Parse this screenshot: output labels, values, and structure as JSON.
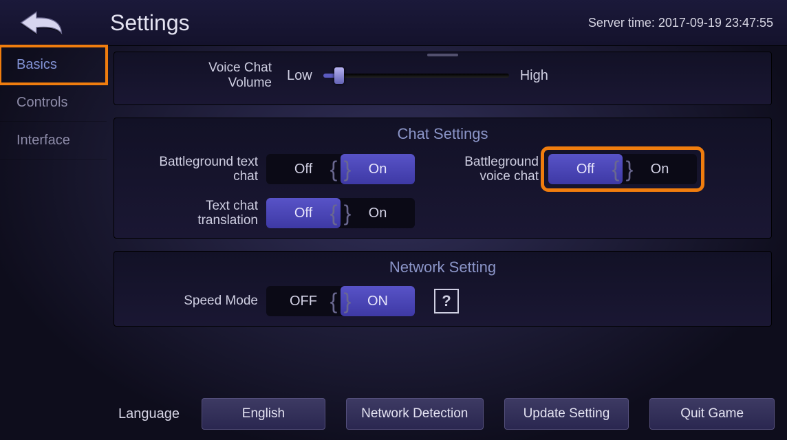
{
  "header": {
    "title": "Settings",
    "server_time_label": "Server time: 2017-09-19 23:47:55"
  },
  "sidebar": {
    "tabs": [
      {
        "label": "Basics"
      },
      {
        "label": "Controls"
      },
      {
        "label": "Interface"
      }
    ]
  },
  "voice_volume": {
    "label_line1": "Voice Chat",
    "label_line2": "Volume",
    "low": "Low",
    "high": "High",
    "value_pct": 6
  },
  "chat": {
    "section": "Chat Settings",
    "bg_text": {
      "label_l1": "Battleground text",
      "label_l2": "chat",
      "off": "Off",
      "on": "On",
      "value": "On"
    },
    "bg_voice": {
      "label_l1": "Battleground",
      "label_l2": "voice chat",
      "off": "Off",
      "on": "On",
      "value": "Off"
    },
    "translate": {
      "label_l1": "Text chat",
      "label_l2": "translation",
      "off": "Off",
      "on": "On",
      "value": "Off"
    }
  },
  "network": {
    "section": "Network Setting",
    "speed": {
      "label": "Speed Mode",
      "off": "OFF",
      "on": "ON",
      "value": "ON"
    },
    "help": "?"
  },
  "footer": {
    "language_label": "Language",
    "language_value": "English",
    "network_detection": "Network Detection",
    "update_setting": "Update Setting",
    "quit_game": "Quit Game"
  }
}
